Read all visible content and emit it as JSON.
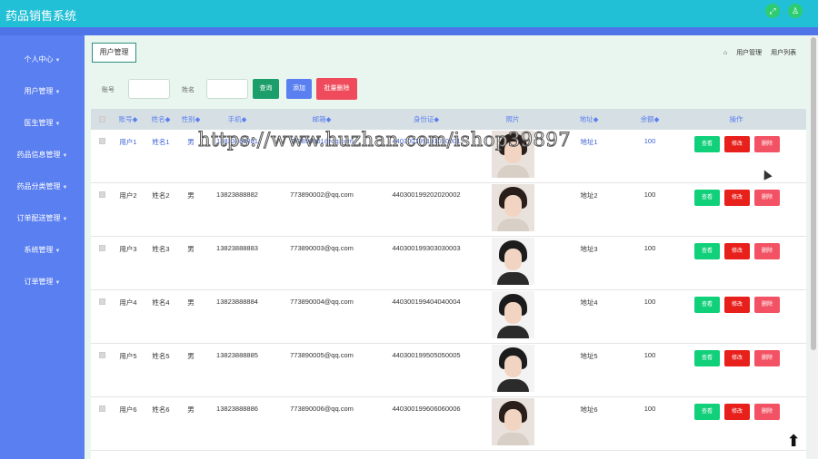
{
  "app": {
    "title": "药品销售系统"
  },
  "topbar": {
    "icons": [
      "expand-icon",
      "user-icon"
    ]
  },
  "sidebar": {
    "items": [
      {
        "label": "个人中心",
        "has_caret": true
      },
      {
        "label": "用户管理",
        "has_caret": true
      },
      {
        "label": "医生管理",
        "has_caret": true
      },
      {
        "label": "药品信息管理",
        "has_caret": true
      },
      {
        "label": "药品分类管理",
        "has_caret": true
      },
      {
        "label": "订单配送管理",
        "has_caret": true
      },
      {
        "label": "系统管理",
        "has_caret": true
      },
      {
        "label": "订单管理",
        "has_caret": true
      }
    ]
  },
  "page": {
    "tab": "用户管理",
    "breadcrumb": [
      "用户管理",
      "用户列表"
    ]
  },
  "search": {
    "account_label": "账号",
    "name_label": "姓名",
    "account_value": "",
    "name_value": "",
    "search_button": "查询",
    "add_button": "添加",
    "batch_delete_button": "批量删除"
  },
  "table": {
    "columns": [
      "账号",
      "姓名",
      "性别",
      "手机",
      "邮箱",
      "身份证",
      "照片",
      "地址",
      "余额",
      "操作"
    ],
    "sortable_marker": "◆",
    "action_labels": {
      "view": "查看",
      "edit": "修改",
      "delete": "删除"
    },
    "rows": [
      {
        "account": "用户1",
        "name": "姓名1",
        "gender": "男",
        "phone": "13823888881",
        "email": "773890001@qq.com",
        "id_card": "440300199101010001",
        "address": "地址1",
        "balance": "100",
        "photo": "female-portrait"
      },
      {
        "account": "用户2",
        "name": "姓名2",
        "gender": "男",
        "phone": "13823888882",
        "email": "773890002@qq.com",
        "id_card": "440300199202020002",
        "address": "地址2",
        "balance": "100",
        "photo": "female-portrait"
      },
      {
        "account": "用户3",
        "name": "姓名3",
        "gender": "男",
        "phone": "13823888883",
        "email": "773890003@qq.com",
        "id_card": "440300199303030003",
        "address": "地址3",
        "balance": "100",
        "photo": "male-portrait"
      },
      {
        "account": "用户4",
        "name": "姓名4",
        "gender": "男",
        "phone": "13823888884",
        "email": "773890004@qq.com",
        "id_card": "440300199404040004",
        "address": "地址4",
        "balance": "100",
        "photo": "male-portrait"
      },
      {
        "account": "用户5",
        "name": "姓名5",
        "gender": "男",
        "phone": "13823888885",
        "email": "773890005@qq.com",
        "id_card": "440300199505050005",
        "address": "地址5",
        "balance": "100",
        "photo": "male-portrait"
      },
      {
        "account": "用户6",
        "name": "姓名6",
        "gender": "男",
        "phone": "13823888886",
        "email": "773890006@qq.com",
        "id_card": "440300199606060006",
        "address": "地址6",
        "balance": "100",
        "photo": "female-portrait"
      }
    ]
  },
  "watermark": "https://www.huzhan.com/ishop39897",
  "back_to_top_icon": "arrow-up-icon",
  "colors": {
    "topbar": "#22c0d6",
    "sidebar": "#5a7ff0",
    "view_button": "#11d07a",
    "edit_button": "#e8201c",
    "delete_button": "#f25263"
  }
}
